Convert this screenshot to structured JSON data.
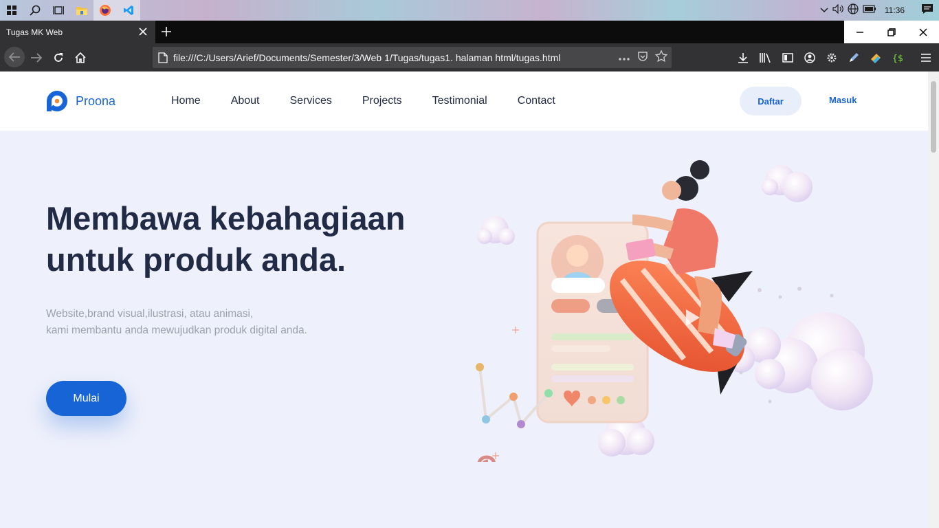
{
  "taskbar": {
    "icons": [
      "start-icon",
      "search-icon",
      "task-view-icon",
      "file-explorer-icon",
      "firefox-icon",
      "vscode-icon"
    ],
    "tray_icons": [
      "chevron-up-icon",
      "volume-icon",
      "network-icon",
      "battery-icon",
      "notification-icon"
    ],
    "clock": "11:36"
  },
  "browser": {
    "tab_title": "Tugas MK Web",
    "url": "file:///C:/Users/Arief/Documents/Semester/3/Web 1/Tugas/tugas1. halaman html/tugas.html"
  },
  "site": {
    "brand": "Proona",
    "menu": [
      "Home",
      "About",
      "Services",
      "Projects",
      "Testimonial",
      "Contact"
    ],
    "daftar_label": "Daftar",
    "masuk_label": "Masuk",
    "hero_title_line1": "Membawa kebahagiaan",
    "hero_title_line2": "untuk produk anda.",
    "hero_sub_line1": "Website,brand visual,ilustrasi, atau animasi,",
    "hero_sub_line2": "kami membantu anda mewujudkan produk digital anda.",
    "cta_label": "Mulai"
  },
  "colors": {
    "primary": "#1764d6",
    "heading": "#222b45",
    "background": "#eef0fb",
    "muted_text": "#9aa0ad"
  }
}
